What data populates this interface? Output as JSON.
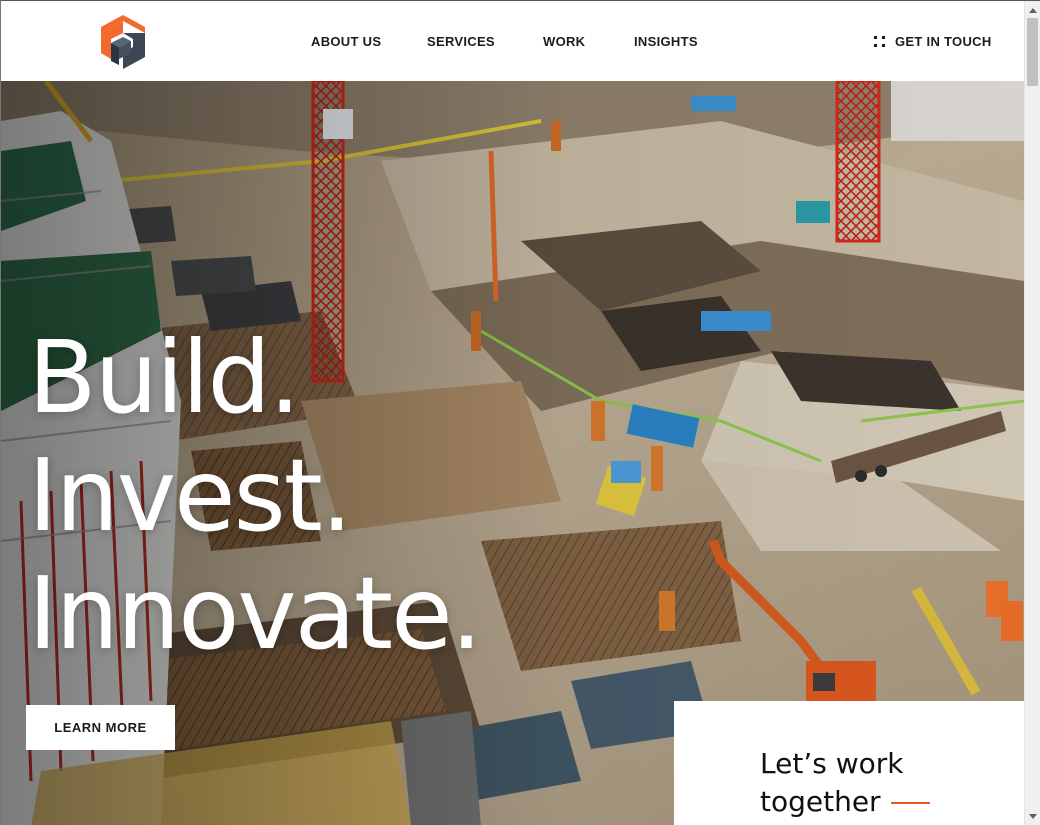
{
  "nav": {
    "items": [
      "ABOUT US",
      "SERVICES",
      "WORK",
      "INSIGHTS"
    ],
    "contact_label": "GET IN TOUCH"
  },
  "hero": {
    "headline": [
      "Build.",
      "Invest.",
      "Innovate."
    ],
    "cta_button": "LEARN MORE"
  },
  "panel": {
    "title_line1": "Let’s work",
    "title_line2": "together"
  },
  "icons": {
    "logo": "cube-logo",
    "contact": "grid-dots-icon"
  },
  "colors": {
    "accent": "#e2572b",
    "logo_orange": "#f26a2e",
    "logo_slate": "#3c4655",
    "text": "#1c1c1c"
  }
}
